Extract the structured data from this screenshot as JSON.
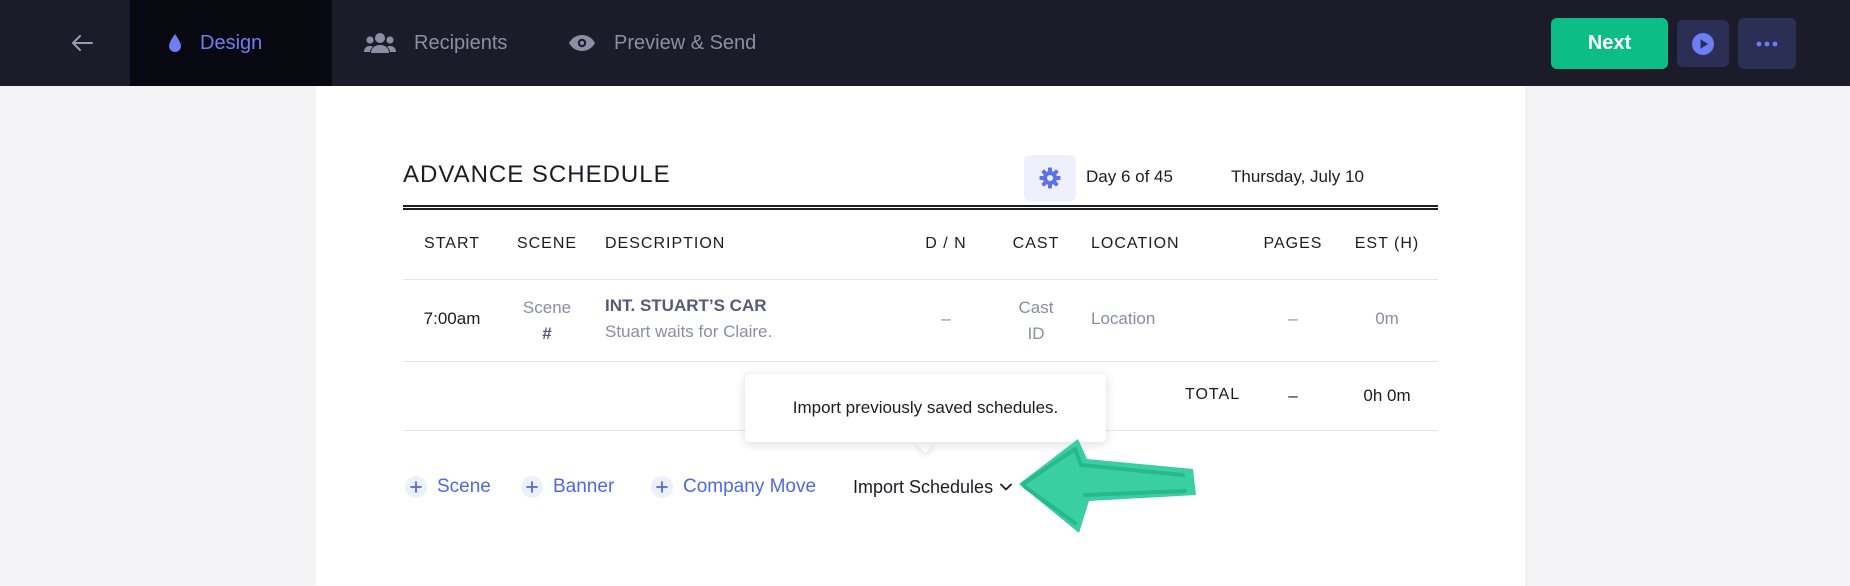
{
  "nav": {
    "tabs": [
      {
        "label": "Design",
        "icon": "drop-icon",
        "active": true
      },
      {
        "label": "Recipients",
        "icon": "users-icon"
      },
      {
        "label": "Preview & Send",
        "icon": "eye-icon"
      }
    ],
    "next_label": "Next"
  },
  "schedule": {
    "title": "ADVANCE SCHEDULE",
    "day": "Day 6 of 45",
    "date": "Thursday, July 10",
    "columns": [
      "START",
      "SCENE",
      "DESCRIPTION",
      "D / N",
      "CAST",
      "LOCATION",
      "PAGES",
      "EST (H)"
    ],
    "rows": [
      {
        "start": "7:00am",
        "scene_line1": "Scene",
        "scene_line2": "#",
        "desc_title": "INT. STUART’S CAR",
        "desc_sub": "Stuart waits for Claire.",
        "dn": "–",
        "cast_line1": "Cast",
        "cast_line2": "ID",
        "location": "Location",
        "pages": "–",
        "est": "0m"
      }
    ],
    "total": {
      "label": "TOTAL",
      "pages": "–",
      "est": "0h 0m"
    }
  },
  "tooltip": "Import previously saved schedules.",
  "actions": {
    "scene": "Scene",
    "banner": "Banner",
    "company_move": "Company Move",
    "import": "Import Schedules"
  },
  "colors": {
    "accent": "#4e68ea",
    "next_green": "#0cbd86",
    "annotation_arrow": "#2fcc9c",
    "nav_bg": "#1b1b2a"
  }
}
